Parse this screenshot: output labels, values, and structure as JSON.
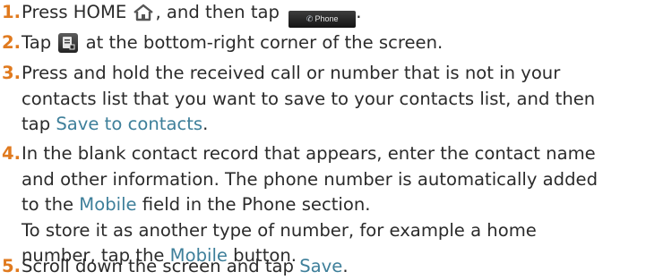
{
  "steps": [
    {
      "number": "1.",
      "parts": {
        "text_a": "Press HOME ",
        "text_b": ", and then tap ",
        "text_c": ".",
        "phone_tab_label": "Phone"
      }
    },
    {
      "number": "2.",
      "parts": {
        "text_a": "Tap ",
        "text_b": " at the bottom-right corner of the screen."
      }
    },
    {
      "number": "3.",
      "parts": {
        "line1": "Press and hold the received call or number that is not in your",
        "line2": "contacts list that you want to save to your contacts list, and then",
        "line3_a": "tap ",
        "line3_em": "Save to contacts",
        "line3_b": "."
      }
    },
    {
      "number": "4.",
      "parts": {
        "line1": "In the blank contact record that appears, enter the contact name",
        "line2": "and other information. The phone number is automatically added",
        "line3_a": "to the ",
        "line3_em": "Mobile",
        "line3_b": " field in the Phone section.",
        "line4": "To store it as another type of number, for example a home",
        "line5_a": "number, tap the ",
        "line5_em": "Mobile",
        "line5_b": " button."
      }
    },
    {
      "number": "5.",
      "parts": {
        "text_a": "Scroll down the screen and tap ",
        "text_em": "Save",
        "text_b": "."
      }
    }
  ],
  "icons": {
    "home": "home-icon",
    "phone_tab": "phone-tab-icon",
    "menu": "menu-icon"
  },
  "colors": {
    "number": "#e07a1f",
    "emphasis": "#3e7f9a",
    "text": "#2b2b2b"
  }
}
